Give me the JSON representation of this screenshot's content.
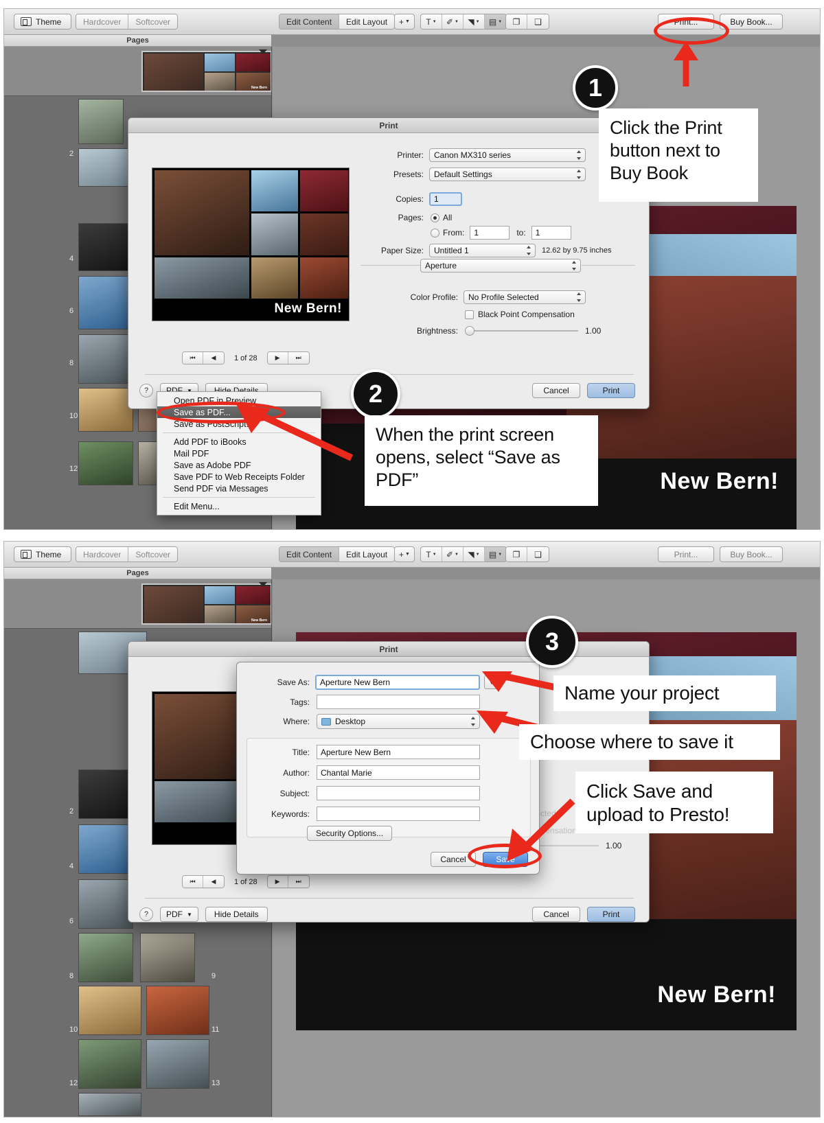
{
  "accent_red": "#e8291c",
  "toolbar": {
    "theme_label": "Theme",
    "hardcover_label": "Hardcover",
    "softcover_label": "Softcover",
    "edit_content_label": "Edit Content",
    "edit_layout_label": "Edit Layout",
    "add_label": "+",
    "text_label": "T",
    "text_box_label": "✐",
    "shape_label": "◥",
    "metadata_label": "▤",
    "arrange_front_label": "❐",
    "arrange_back_label": "❑",
    "print_label": "Print...",
    "buy_book_label": "Buy Book..."
  },
  "sidebar": {
    "header": "Pages",
    "page_numbers": [
      "2",
      "4",
      "6",
      "8",
      "10",
      "12",
      "9",
      "11",
      "13"
    ]
  },
  "canvas": {
    "book_title": "New Bern!"
  },
  "print_dialog": {
    "title": "Print",
    "preview_caption": "New Bern!",
    "printer_label": "Printer:",
    "printer_value": "Canon MX310 series",
    "presets_label": "Presets:",
    "presets_value": "Default Settings",
    "copies_label": "Copies:",
    "copies_value": "1",
    "pages_label": "Pages:",
    "pages_all_label": "All",
    "pages_from_label": "From:",
    "pages_from_value": "1",
    "pages_to_label": "to:",
    "pages_to_value": "1",
    "paper_size_label": "Paper Size:",
    "paper_size_value": "Untitled 1",
    "paper_dimensions": "12.62 by 9.75 inches",
    "module_value": "Aperture",
    "color_profile_label": "Color Profile:",
    "color_profile_value": "No Profile Selected",
    "black_point_label": "Black Point Compensation",
    "brightness_label": "Brightness:",
    "brightness_value": "1.00",
    "page_indicator": "1 of 28",
    "help_label": "?",
    "pdf_label": "PDF",
    "hide_details_label": "Hide Details",
    "cancel_label": "Cancel",
    "print_label": "Print"
  },
  "pdf_menu": {
    "items": [
      "Open PDF in Preview",
      "Save as PDF...",
      "Save as PostScript...",
      "Add PDF to iBooks",
      "Mail PDF",
      "Save as Adobe PDF",
      "Save PDF to Web Receipts Folder",
      "Send PDF via Messages",
      "Edit Menu..."
    ],
    "selected": "Save as PDF..."
  },
  "save_dialog": {
    "title": "Print",
    "save_as_label": "Save As:",
    "save_as_value": "Aperture New Bern",
    "tags_label": "Tags:",
    "tags_value": "",
    "where_label": "Where:",
    "where_value": "Desktop",
    "title_label": "Title:",
    "title_value": "Aperture New Bern",
    "author_label": "Author:",
    "author_value": "Chantal Marie",
    "subject_label": "Subject:",
    "subject_value": "",
    "keywords_label": "Keywords:",
    "keywords_value": "",
    "security_options_label": "Security Options...",
    "cancel_label": "Cancel",
    "save_label": "Save"
  },
  "annotations": {
    "step1_number": "1",
    "step1_text": "Click the Print button next to Buy Book",
    "step2_number": "2",
    "step2_text": "When the print screen opens, select “Save as PDF”",
    "step3_number": "3",
    "step3_text_a": "Name your project",
    "step3_text_b": "Choose where to save it",
    "step3_text_c": "Click Save and upload to Presto!"
  }
}
